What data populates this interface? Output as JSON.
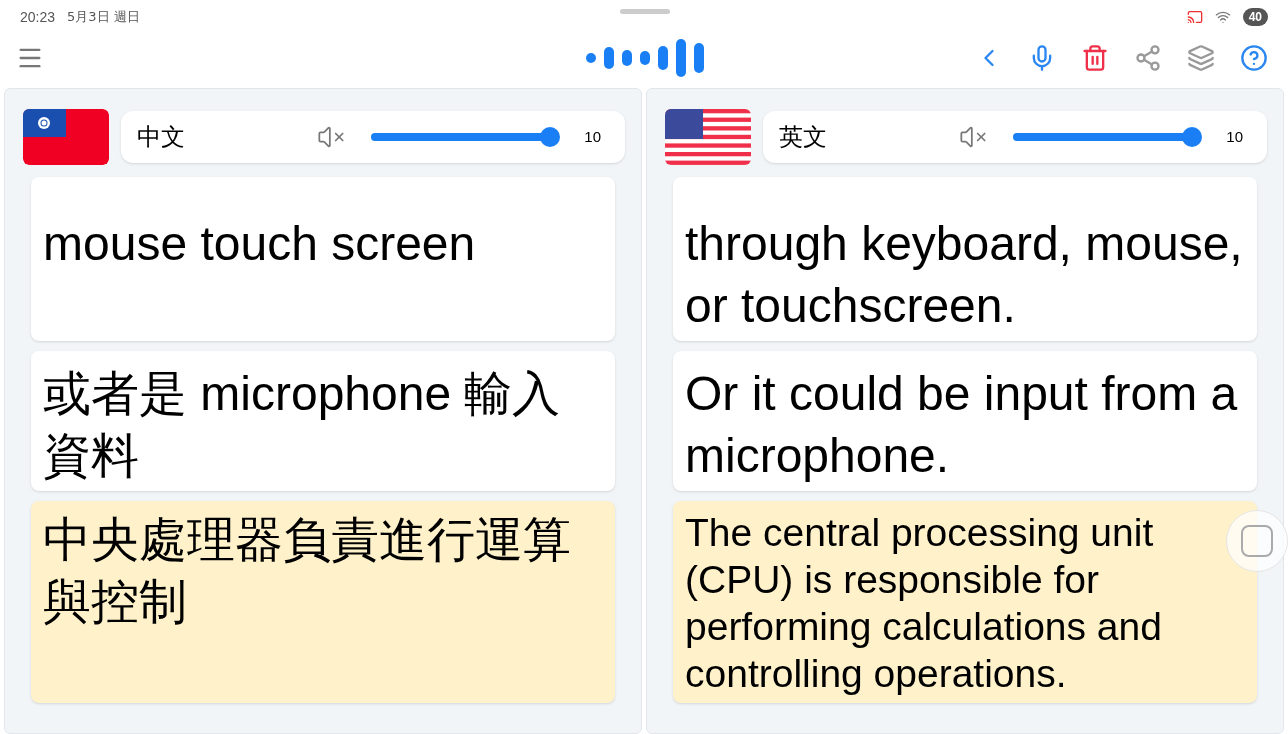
{
  "status_bar": {
    "time": "20:23",
    "date": "5月3日 週日",
    "battery": "40"
  },
  "panels": [
    {
      "kind": "taiwan",
      "language": "中文",
      "muted": true,
      "volume": {
        "level": 1.0,
        "reading": "10"
      },
      "cards": [
        {
          "text": "mouse touch screen",
          "selected": false
        },
        {
          "text": "或者是 microphone 輸入資料",
          "selected": false
        },
        {
          "text": "中央處理器負責進行運算與控制",
          "selected": true
        }
      ]
    },
    {
      "kind": "usa",
      "language": "英文",
      "muted": true,
      "volume": {
        "level": 1.0,
        "reading": "10"
      },
      "cards": [
        {
          "text": "through keyboard, mouse, or touchscreen.",
          "selected": false
        },
        {
          "text": "Or it could be input from a microphone.",
          "selected": false
        },
        {
          "text": "The central processing unit (CPU) is responsible for performing calculations and controlling operations.",
          "selected": true,
          "kind": "small"
        }
      ]
    }
  ]
}
